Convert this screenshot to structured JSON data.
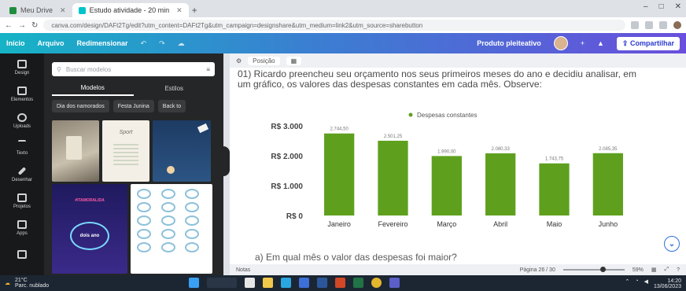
{
  "browser": {
    "tabs": [
      {
        "label": "Meu Drive",
        "icon": "drive-favicon",
        "color": "#1e8e3e"
      },
      {
        "label": "Estudo atividade - 20 min",
        "icon": "canva-favicon",
        "color": "#00c4cc"
      }
    ],
    "new_tab_label": "+",
    "window_controls": {
      "minimize": "–",
      "maximize": "□",
      "close": "✕"
    },
    "url": "canva.com/design/DAFt2Tg/edit?utm_content=DAFt2Tg&utm_campaign=designshare&utm_medium=link2&utm_source=sharebutton"
  },
  "canva_bar": {
    "home": "Início",
    "file": "Arquivo",
    "resize": "Redimensionar",
    "undo_icon": "undo-icon",
    "redo_icon": "redo-icon",
    "cloud_icon": "cloud-icon",
    "premium": "Produto pleiteativo",
    "share": "Compartilhar",
    "share_icon": "upload-icon"
  },
  "rail": [
    {
      "label": "Design",
      "icon": "design-icon"
    },
    {
      "label": "Elementos",
      "icon": "elements-icon"
    },
    {
      "label": "Uploads",
      "icon": "upload-icon"
    },
    {
      "label": "Texto",
      "icon": "text-icon"
    },
    {
      "label": "Desenhar",
      "icon": "draw-icon"
    },
    {
      "label": "Projetos",
      "icon": "folder-icon"
    },
    {
      "label": "Apps",
      "icon": "apps-icon"
    },
    {
      "label": "",
      "icon": "photos-icon"
    }
  ],
  "panel": {
    "search_placeholder": "Buscar modelos",
    "tabs": [
      "Modelos",
      "Estilos"
    ],
    "chips": [
      "Dia dos namorados",
      "Festa Junina",
      "Back to"
    ],
    "thumbs": [
      {
        "title": "",
        "sub": ""
      },
      {
        "title": "Sport",
        "sub": ""
      },
      {
        "title": "",
        "sub": ""
      },
      {
        "title": "#ITAMORALIDA",
        "sub": "dois ano"
      },
      {
        "title": "",
        "sub": ""
      }
    ]
  },
  "canvas_toolbar": {
    "position": "Posição",
    "grid_icon": "grid-icon"
  },
  "question": {
    "text": "01) Ricardo preencheu seu orçamento nos seus primeiros meses do ano e decidiu analisar, em um gráfico, os valores das despesas constantes em cada mês. Observe:",
    "next": "a) Em qual mês o valor das despesas foi maior?"
  },
  "chart_data": {
    "type": "bar",
    "title": "",
    "legend": [
      "Despesas constantes"
    ],
    "legend_position": "top",
    "categories": [
      "Janeiro",
      "Fevereiro",
      "Março",
      "Abril",
      "Maio",
      "Junho"
    ],
    "values": [
      2744.5,
      2501.25,
      1990.0,
      2080.33,
      1743.75,
      2085.35
    ],
    "data_labels": [
      "2.744,50",
      "2.501,25",
      "1.990,00",
      "2.080,33",
      "1.743,75",
      "2.085,35"
    ],
    "y_ticks": [
      "R$ 0",
      "R$ 1.000",
      "R$ 2.000",
      "R$ 3.000"
    ],
    "y_tick_values": [
      0,
      1000,
      2000,
      3000
    ],
    "ylim": [
      0,
      3000
    ],
    "grid": false,
    "color": "#5ea01e"
  },
  "canvas_bottom": {
    "notes": "Notas",
    "page_indicator": "Página 26 / 30",
    "zoom": "59%",
    "zoom_fraction": 0.6
  },
  "taskbar": {
    "weather": "21°C",
    "weather_sub": "Parc. nublado",
    "search": "Pesquisar",
    "time": "14:20",
    "date": "13/06/2023"
  }
}
